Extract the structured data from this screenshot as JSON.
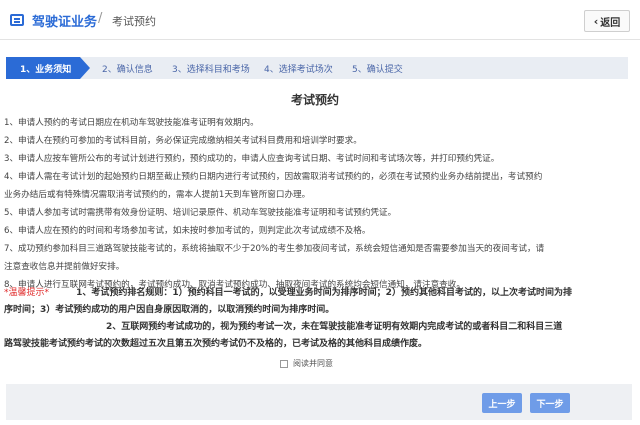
{
  "header": {
    "title": "驾驶证业务",
    "separator": "/",
    "breadcrumb": "考试预约",
    "back_label": "返回"
  },
  "steps": [
    {
      "label": "1、业务须知",
      "active": true
    },
    {
      "label": "2、确认信息",
      "active": false
    },
    {
      "label": "3、选择科目和考场",
      "active": false
    },
    {
      "label": "4、选择考试场次",
      "active": false
    },
    {
      "label": "5、确认提交",
      "active": false
    }
  ],
  "content": {
    "title": "考试预约",
    "rules": [
      "1、申请人预约的考试日期应在机动车驾驶技能准考证明有效期内。",
      "2、申请人在预约可参加的考试科目前，务必保证完成缴纳相关考试科目费用和培训学时要求。",
      "3、申请人应按车管所公布的考试计划进行预约，预约成功的，申请人应查询考试日期、考试时间和考试场次等，并打印预约凭证。",
      "4、申请人需在考试计划的起始预约日期至截止预约日期内进行考试预约，因故需取消考试预约的，必须在考试预约业务办结前提出，考试预约",
      "业务办结后或有特殊情况需取消考试预约的，需本人提前1天到车管所窗口办理。",
      "5、申请人参加考试时需携带有效身份证明、培训记录原件、机动车驾驶技能准考证明和考试预约凭证。",
      "6、申请人应在预约的时间和考场参加考试，如未按时参加考试的，则判定此次考试成绩不及格。",
      "7、成功预约参加科目三道路驾驶技能考试的，系统将抽取不少于20%的考生参加夜间考试，系统会短信通知是否需要参加当天的夜间考试，请",
      "注意查收信息并提前做好安排。",
      "8、申请人进行互联网考试预约的，考试预约成功、取消考试预约成功、抽取夜间考试的系统均会短信通知，请注意查收。"
    ],
    "tips_label": "*温馨提示*",
    "tip1_a": "1、考试预约排名规则：1）预约科目一考试的，以受理业务时间为排序时间；2）预约其他科目考试的，以上次考试时间为排",
    "tip1_b": "序时间；3）考试预约成功的用户因自身原因取消的，以取消预约时间为排序时间。",
    "tip2_a": "2、互联网预约考试成功的，视为预约考试一次，未在驾驶技能准考证明有效期内完成考试的或者科目二和科目三道",
    "tip2_b": "路驾驶技能考试预约考试的次数超过五次且第五次预约考试仍不及格的，已考试及格的其他科目成绩作废。",
    "agree_label": "阅读并同意",
    "agree_checked": false
  },
  "footer": {
    "prev_label": "上一步",
    "next_label": "下一步"
  },
  "colors": {
    "accent": "#2b6bd6",
    "button": "#6f9ce8",
    "warning": "#e02b2b"
  }
}
